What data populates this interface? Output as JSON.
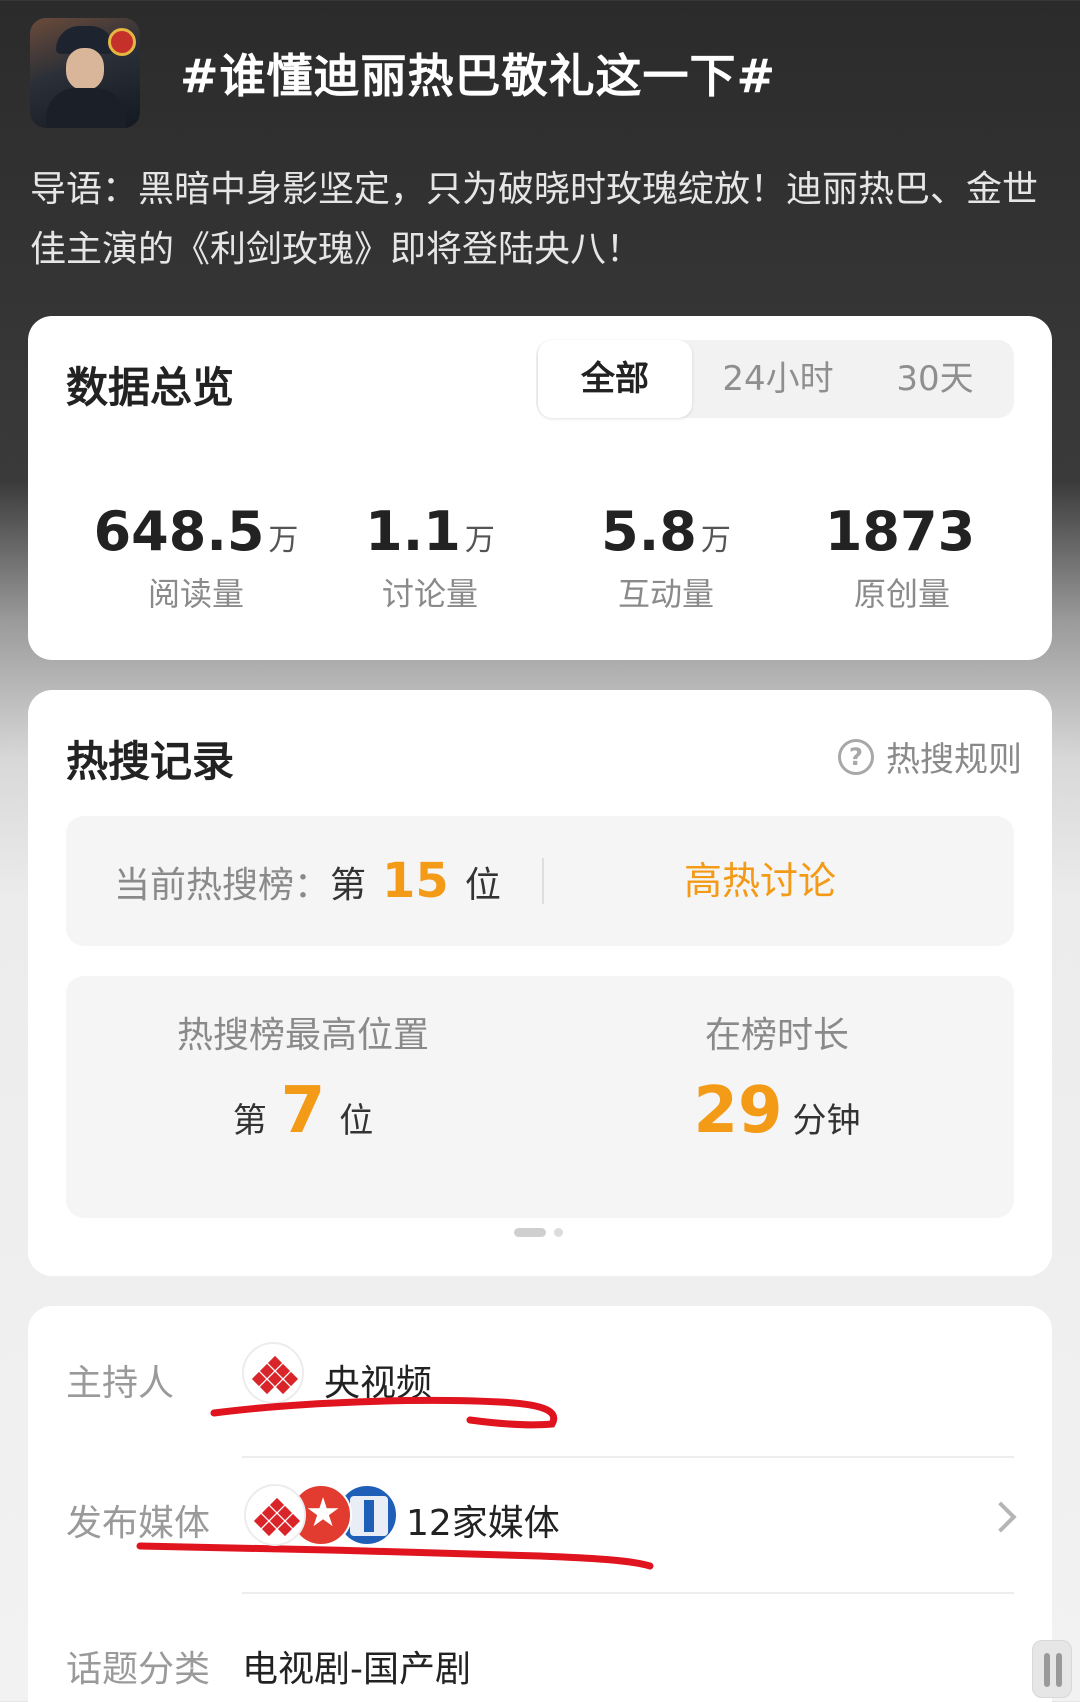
{
  "topic": {
    "title": "#谁懂迪丽热巴敬礼这一下#",
    "intro": "导语：黑暗中身影坚定，只为破晓时玫瑰绽放！迪丽热巴、金世佳主演的《利剑玫瑰》即将登陆央八！"
  },
  "overview": {
    "title": "数据总览",
    "tabs": [
      "全部",
      "24小时",
      "30天"
    ],
    "active_tab": "全部",
    "stats": [
      {
        "value": "648.5",
        "unit": "万",
        "label": "阅读量"
      },
      {
        "value": "1.1",
        "unit": "万",
        "label": "讨论量"
      },
      {
        "value": "5.8",
        "unit": "万",
        "label": "互动量"
      },
      {
        "value": "1873",
        "unit": "",
        "label": "原创量"
      }
    ]
  },
  "hot": {
    "title": "热搜记录",
    "rules_icon": "question-circle-icon",
    "rules_label": "热搜规则",
    "current_label": "当前热搜榜：",
    "current_prefix": "第",
    "current_rank": "15",
    "current_suffix": "位",
    "tag": "高热讨论",
    "peak_label": "热搜榜最高位置",
    "peak_prefix": "第",
    "peak_rank": "7",
    "peak_suffix": "位",
    "duration_label": "在榜时长",
    "duration_value": "29",
    "duration_unit": "分钟",
    "accent_color": "#f39a16"
  },
  "info": {
    "host_label": "主持人",
    "host_value": "央视频",
    "media_label": "发布媒体",
    "media_value": "12家媒体",
    "category_label": "话题分类",
    "category_value": "电视剧-国产剧",
    "annotation_color": "#e0141e"
  }
}
